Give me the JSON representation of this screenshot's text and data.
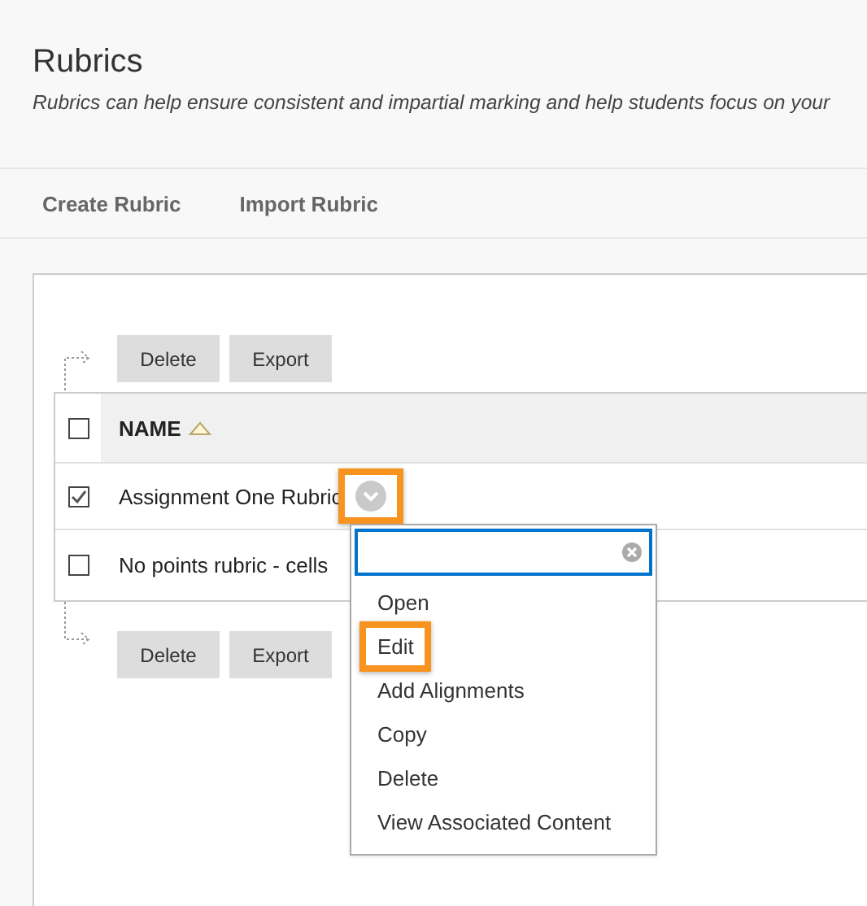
{
  "page": {
    "title": "Rubrics",
    "description": "Rubrics can help ensure consistent and impartial marking and help students focus on your"
  },
  "actions": [
    {
      "label": "Create Rubric"
    },
    {
      "label": "Import Rubric"
    }
  ],
  "top_buttons": [
    "Delete",
    "Export"
  ],
  "table": {
    "header_checked": false,
    "columns": [
      {
        "label": "NAME",
        "sorted": true
      }
    ],
    "rows": [
      {
        "name": "Assignment One Rubric",
        "checked": true,
        "menu_button": {
          "highlighted": true
        }
      },
      {
        "name": "No points rubric - cells",
        "checked": false
      }
    ]
  },
  "bottom_buttons": [
    "Delete",
    "Export"
  ],
  "context_menu": {
    "items": [
      {
        "label": "Open",
        "highlighted": false
      },
      {
        "label": "Edit",
        "highlighted": true
      },
      {
        "label": "Add Alignments",
        "highlighted": false
      },
      {
        "label": "Copy",
        "highlighted": false
      },
      {
        "label": "Delete",
        "highlighted": false
      },
      {
        "label": "View Associated Content",
        "highlighted": false
      }
    ]
  }
}
